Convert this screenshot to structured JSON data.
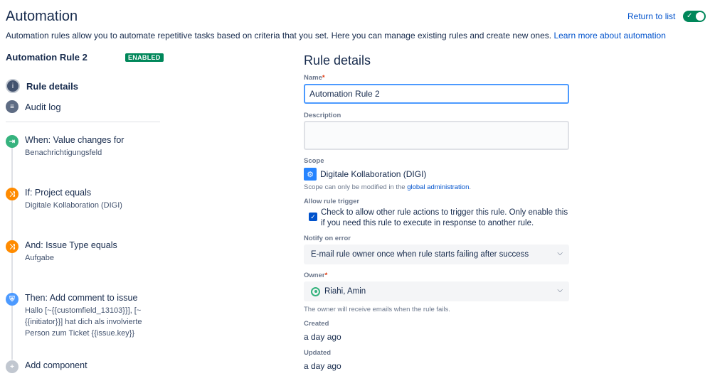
{
  "header": {
    "title": "Automation",
    "description": "Automation rules allow you to automate repetitive tasks based on criteria that you set. Here you can manage existing rules and create new ones.",
    "learn_more": "Learn more about automation",
    "return_to_list": "Return to list",
    "toggle_on": true
  },
  "sidebar": {
    "rule_name": "Automation Rule 2",
    "status_badge": "ENABLED",
    "nav": [
      {
        "label": "Rule details",
        "icon": "info-icon",
        "active": true
      },
      {
        "label": "Audit log",
        "icon": "audit-log-icon",
        "active": false
      }
    ],
    "components": [
      {
        "title": "When: Value changes for",
        "subtitle": "Benachrichtigungsfeld",
        "icon": "trigger-icon"
      },
      {
        "title": "If: Project equals",
        "subtitle": "Digitale Kollaboration (DIGI)",
        "icon": "condition-icon"
      },
      {
        "title": "And: Issue Type equals",
        "subtitle": "Aufgabe",
        "icon": "condition-icon"
      },
      {
        "title": "Then: Add comment to issue",
        "subtitle": "Hallo [~{{customfield_13103}}], [~{{initiator}}] hat dich als involvierte Person zum Ticket {{issue.key}}",
        "icon": "action-icon"
      }
    ],
    "add_component": "Add component"
  },
  "details": {
    "title": "Rule details",
    "name_label": "Name",
    "name_value": "Automation Rule 2",
    "description_label": "Description",
    "description_value": "",
    "scope_label": "Scope",
    "scope_value": "Digitale Kollaboration (DIGI)",
    "scope_help_prefix": "Scope can only be modified in the",
    "scope_help_link": "global administration",
    "scope_help_suffix": ".",
    "allow_trigger_label": "Allow rule trigger",
    "allow_trigger_checked": true,
    "allow_trigger_text": "Check to allow other rule actions to trigger this rule. Only enable this if you need this rule to execute in response to another rule.",
    "notify_label": "Notify on error",
    "notify_value": "E-mail rule owner once when rule starts failing after success",
    "owner_label": "Owner",
    "owner_value": "Riahi, Amin",
    "owner_help": "The owner will receive emails when the rule fails.",
    "created_label": "Created",
    "created_value": "a day ago",
    "updated_label": "Updated",
    "updated_value": "a day ago"
  },
  "colors": {
    "enabled": "#00875a",
    "link": "#0052cc",
    "trigger": "#36b37e",
    "condition": "#ff8b00",
    "action": "#4c9aff"
  }
}
